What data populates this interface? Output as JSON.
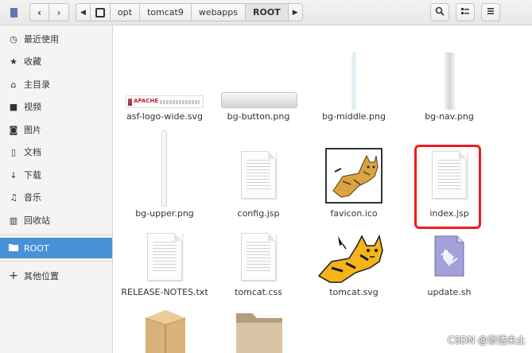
{
  "header": {
    "crumbs": [
      "opt",
      "tomcat9",
      "webapps",
      "ROOT"
    ]
  },
  "sidebar": {
    "items": [
      {
        "label": "最近使用",
        "icon": "clock-icon",
        "glyph": "◷"
      },
      {
        "label": "收藏",
        "icon": "star-icon",
        "glyph": "★"
      },
      {
        "label": "主目录",
        "icon": "home-icon",
        "glyph": "⌂"
      },
      {
        "label": "视频",
        "icon": "video-icon",
        "glyph": "■"
      },
      {
        "label": "图片",
        "icon": "camera-icon",
        "glyph": "◙"
      },
      {
        "label": "文档",
        "icon": "document-icon",
        "glyph": "▯"
      },
      {
        "label": "下载",
        "icon": "download-icon",
        "glyph": "↓"
      },
      {
        "label": "音乐",
        "icon": "music-icon",
        "glyph": "♫"
      },
      {
        "label": "回收站",
        "icon": "trash-icon",
        "glyph": "▥"
      }
    ],
    "root_label": "ROOT",
    "other_label": "其他位置"
  },
  "files": [
    {
      "name": "asf-logo-wide.svg"
    },
    {
      "name": "bg-button.png"
    },
    {
      "name": "bg-middle.png"
    },
    {
      "name": "bg-nav.png"
    },
    {
      "name": "bg-upper.png"
    },
    {
      "name": "config.jsp"
    },
    {
      "name": "favicon.ico"
    },
    {
      "name": "index.jsp"
    },
    {
      "name": "RELEASE-NOTES.txt"
    },
    {
      "name": "tomcat.css"
    },
    {
      "name": "tomcat.svg"
    },
    {
      "name": "update.sh"
    }
  ],
  "asf_logo_text": "APACHE",
  "watermark": "CSDN @渗透未止",
  "colors": {
    "selection": "#4a90d9",
    "highlight": "#f01c1c"
  }
}
